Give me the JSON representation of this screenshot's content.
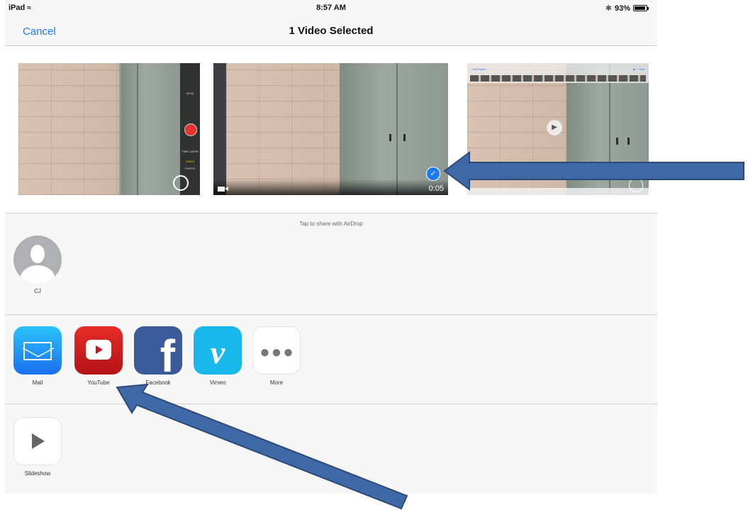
{
  "status_bar": {
    "device": "iPad",
    "time": "8:57 AM",
    "battery": "93%"
  },
  "nav": {
    "cancel_label": "Cancel",
    "title": "1 Video Selected"
  },
  "thumbnails": {
    "selected_duration": "0:05"
  },
  "airdrop": {
    "hint": "Tap to share with AirDrop",
    "people": [
      {
        "name": "CJ"
      }
    ]
  },
  "share_apps": [
    {
      "label": "Mail",
      "icon": "mail-icon"
    },
    {
      "label": "YouTube",
      "icon": "youtube-icon"
    },
    {
      "label": "Facebook",
      "icon": "facebook-icon"
    },
    {
      "label": "Vimeo",
      "icon": "vimeo-icon"
    },
    {
      "label": "More",
      "icon": "more-icon"
    }
  ],
  "actions": [
    {
      "label": "Slideshow",
      "icon": "play-icon"
    }
  ],
  "colors": {
    "accent": "#1a7cf5",
    "annotation_arrow": "#3f68a6",
    "annotation_arrow_border": "#2c4a78"
  }
}
